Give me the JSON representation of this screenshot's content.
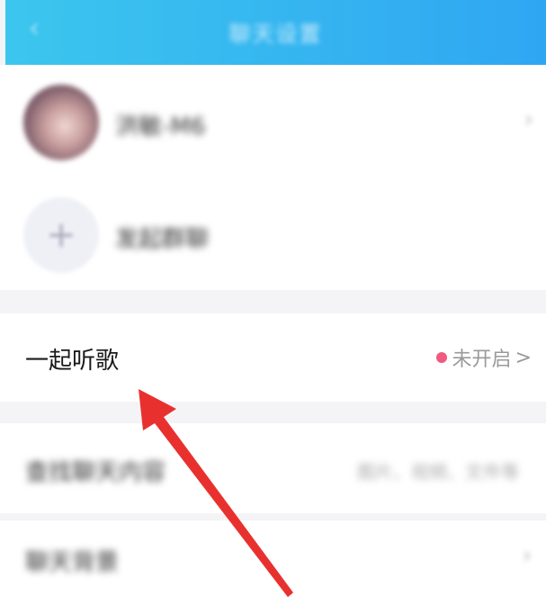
{
  "header": {
    "back_icon": "chevron-left-icon",
    "title": "聊天设置"
  },
  "contacts": [
    {
      "name": "洪敏-M6",
      "avatar": "photo"
    },
    {
      "name": "发起群聊",
      "avatar": "add-icon"
    }
  ],
  "listen_together": {
    "label": "一起听歌",
    "status": "未开启",
    "status_dot_color": "#f05a7e",
    "chevron": ">"
  },
  "search_chat": {
    "label": "查找聊天内容",
    "hint": "图片、视频、文件等"
  },
  "chat_background": {
    "label": "聊天背景"
  },
  "colors": {
    "header_start": "#3cc6ee",
    "header_end": "#2fa6f2",
    "arrow": "#e8312f"
  }
}
